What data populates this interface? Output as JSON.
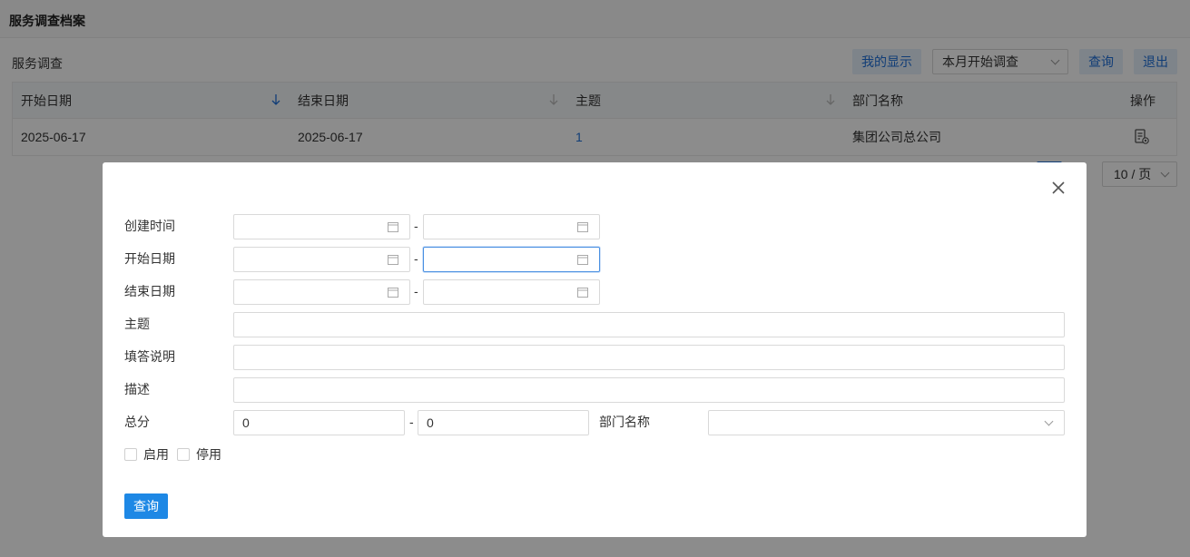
{
  "page": {
    "title": "服务调查档案",
    "section_title": "服务调查",
    "toolbar": {
      "my_display_label": "我的显示",
      "filter_value": "本月开始调查",
      "query_label": "查询",
      "exit_label": "退出"
    },
    "table": {
      "columns": [
        "开始日期",
        "结束日期",
        "主题",
        "部门名称",
        "操作"
      ],
      "rows": [
        {
          "start_date": "2025-06-17",
          "end_date": "2025-06-17",
          "subject": "1",
          "dept": "集团公司总公司",
          "action_icon": "document-view-icon"
        }
      ]
    },
    "pager": {
      "page_size": "10 / 页"
    }
  },
  "modal": {
    "labels": {
      "created_time": "创建时间",
      "start_date": "开始日期",
      "end_date": "结束日期",
      "subject": "主题",
      "fill_note": "填答说明",
      "description": "描述",
      "total_score": "总分",
      "dept_name": "部门名称"
    },
    "range_separator": "-",
    "score_from": "0",
    "score_to": "0",
    "checkbox_enable": "启用",
    "checkbox_disable": "停用",
    "query_label": "查询",
    "icons": {
      "close": "close-icon",
      "calendar": "calendar-icon",
      "dropdown": "chevron-down-icon"
    }
  },
  "colors": {
    "primary": "#1e88e5",
    "link": "#1e6fd9",
    "focus_border": "#4a90e2",
    "mask": "rgba(0,0,0,0.45)"
  }
}
